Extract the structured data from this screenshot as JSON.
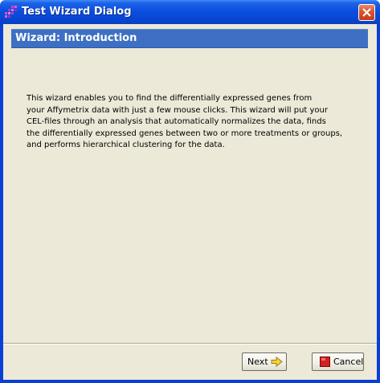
{
  "window": {
    "title": "Test Wizard Dialog",
    "app_icon": "wizard-grid-icon",
    "close_icon": "close-icon"
  },
  "header": {
    "title": "Wizard: Introduction"
  },
  "intro": {
    "lines": [
      "This wizard enables you to find the differentially expressed genes from",
      "your Affymetrix data with just a few mouse clicks. This wizard will put your",
      "CEL-files through an analysis that automatically normalizes the data, finds",
      "the differentially expressed genes between two or more treatments or groups,",
      "and performs hierarchical clustering for the data."
    ]
  },
  "buttons": {
    "next_label": "Next",
    "next_icon": "arrow-right-icon",
    "cancel_label": "Cancel",
    "cancel_icon": "stop-icon"
  },
  "colors": {
    "titlebar": "#0a4fe0",
    "header_bar": "#3d70c3",
    "client_bg": "#ece9d8",
    "close_button": "#d8552f",
    "next_arrow": "#f5d23a",
    "cancel_stop": "#d42020"
  }
}
